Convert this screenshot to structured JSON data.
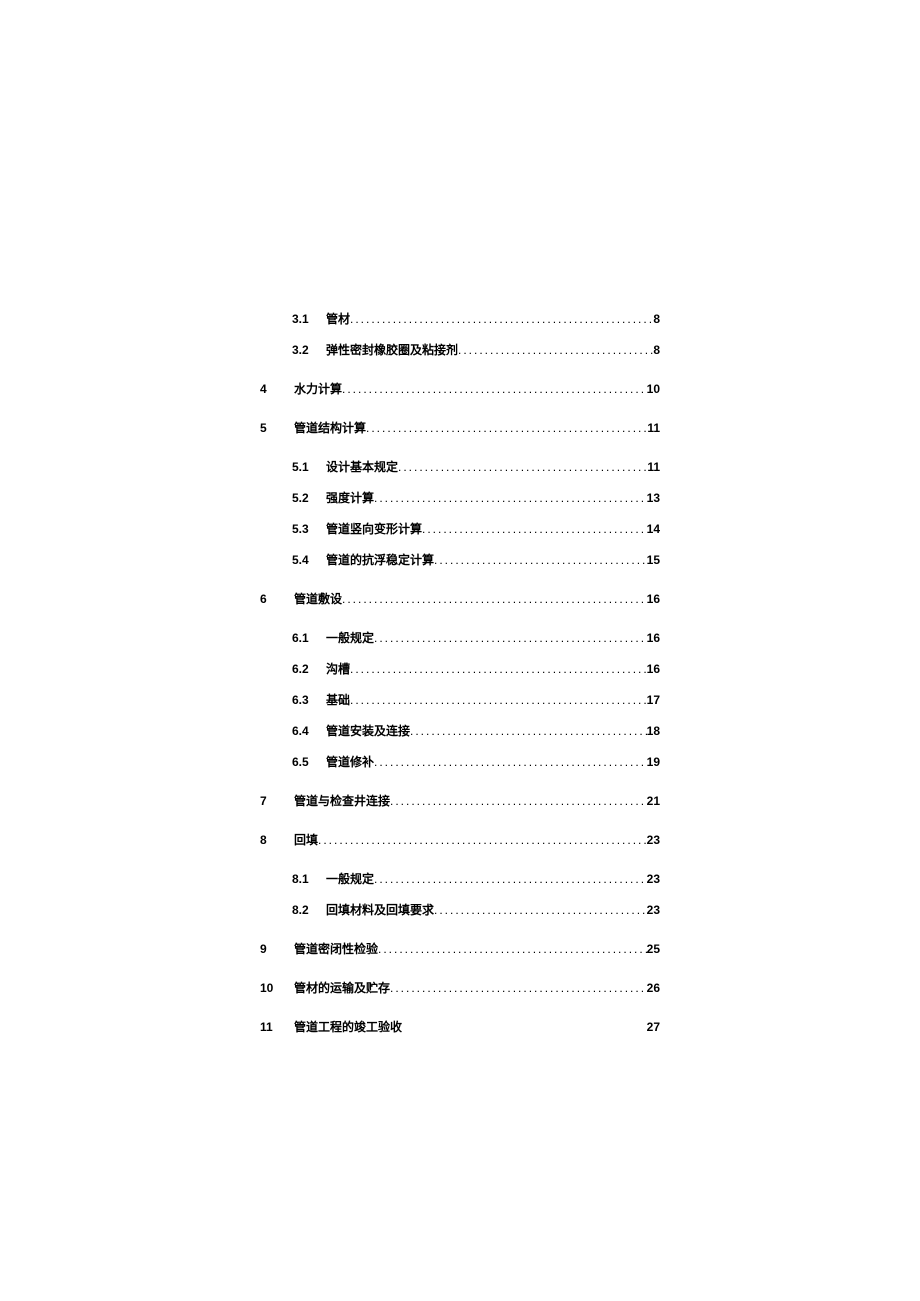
{
  "toc": [
    {
      "level": "sub",
      "num": "3.1",
      "title": "管材",
      "page": "8"
    },
    {
      "level": "sub",
      "num": "3.2",
      "title": "弹性密封橡胶圈及粘接剂",
      "page": "8"
    },
    {
      "level": "top",
      "num": "4",
      "title": "水力计算",
      "page": "10"
    },
    {
      "level": "top",
      "num": "5",
      "title": "管道结构计算",
      "page": "11"
    },
    {
      "level": "sub",
      "num": "5.1",
      "title": "设计基本规定",
      "page": "11"
    },
    {
      "level": "sub",
      "num": "5.2",
      "title": "强度计算",
      "page": "13"
    },
    {
      "level": "sub",
      "num": "5.3",
      "title": "管道竖向变形计算",
      "page": "14"
    },
    {
      "level": "sub",
      "num": "5.4",
      "title": "管道的抗浮稳定计算",
      "page": "15"
    },
    {
      "level": "top",
      "num": "6",
      "title": "管道敷设",
      "page": "16"
    },
    {
      "level": "sub",
      "num": "6.1",
      "title": "一般规定",
      "page": "16"
    },
    {
      "level": "sub",
      "num": "6.2",
      "title": "沟槽",
      "page": "16"
    },
    {
      "level": "sub",
      "num": "6.3",
      "title": "基础",
      "page": "17"
    },
    {
      "level": "sub",
      "num": "6.4",
      "title": "管道安装及连接",
      "page": "18"
    },
    {
      "level": "sub",
      "num": "6.5",
      "title": "管道修补",
      "page": "19"
    },
    {
      "level": "top",
      "num": "7",
      "title": "管道与检查井连接",
      "page": "21"
    },
    {
      "level": "top",
      "num": "8",
      "title": "回填",
      "page": "23"
    },
    {
      "level": "sub",
      "num": "8.1",
      "title": "一般规定",
      "page": "23"
    },
    {
      "level": "sub",
      "num": "8.2",
      "title": "回填材料及回填要求",
      "page": "23"
    },
    {
      "level": "top",
      "num": "9",
      "title": "管道密闭性检验",
      "page": "25"
    },
    {
      "level": "top",
      "num": "10",
      "title": "管材的运输及贮存",
      "page": "26"
    },
    {
      "level": "top",
      "num": "11",
      "title": "管道工程的竣工验收",
      "page": "27",
      "nodots": true
    }
  ]
}
